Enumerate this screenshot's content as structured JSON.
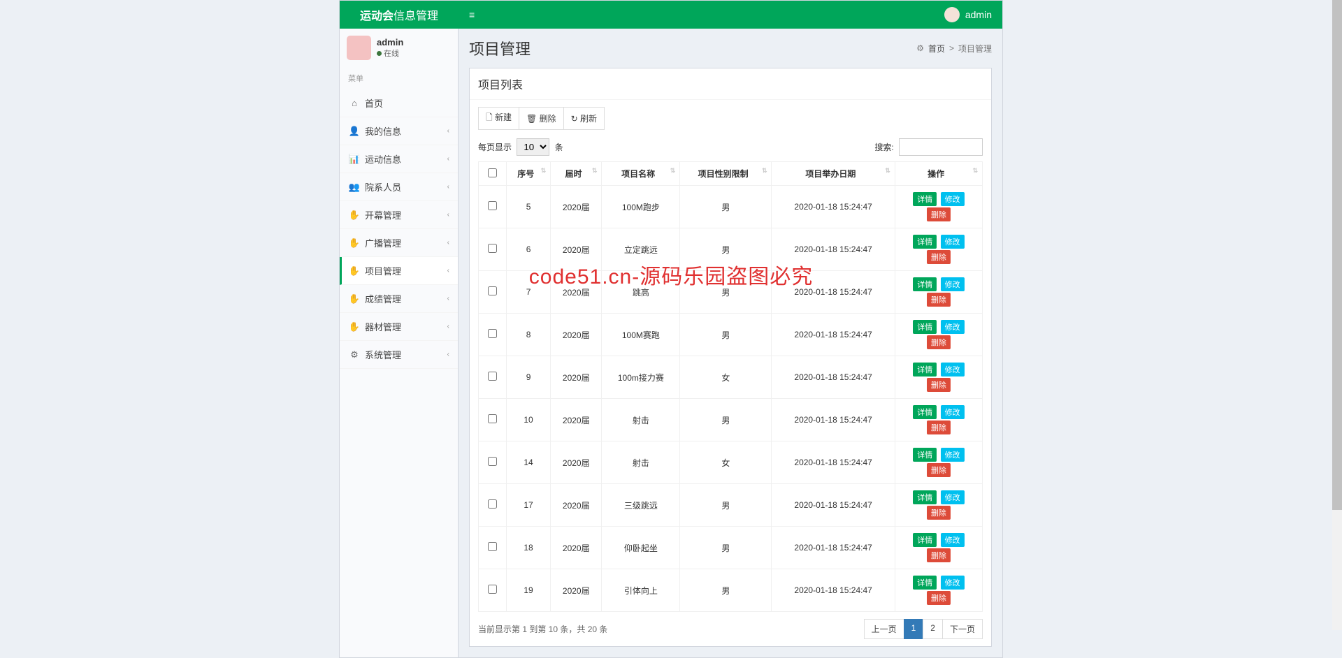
{
  "header": {
    "brand_strong": "运动会",
    "brand_light": "信息管理",
    "user": "admin"
  },
  "sidebar": {
    "user": {
      "name": "admin",
      "status": "在线"
    },
    "menu_header": "菜单",
    "items": [
      {
        "icon": "⌂",
        "label": "首页",
        "expand": false
      },
      {
        "icon": "👤",
        "label": "我的信息",
        "expand": true
      },
      {
        "icon": "📊",
        "label": "运动信息",
        "expand": true
      },
      {
        "icon": "👥",
        "label": "院系人员",
        "expand": true
      },
      {
        "icon": "✋",
        "label": "开幕管理",
        "expand": true
      },
      {
        "icon": "✋",
        "label": "广播管理",
        "expand": true
      },
      {
        "icon": "✋",
        "label": "项目管理",
        "expand": true,
        "active": true
      },
      {
        "icon": "✋",
        "label": "成绩管理",
        "expand": true
      },
      {
        "icon": "✋",
        "label": "器材管理",
        "expand": true
      },
      {
        "icon": "⚙",
        "label": "系统管理",
        "expand": true
      }
    ]
  },
  "content": {
    "title": "项目管理",
    "breadcrumb": {
      "icon": "⚙",
      "home": "首页",
      "sep": ">",
      "current": "项目管理"
    },
    "box_title": "项目列表",
    "toolbar": {
      "new": "新建",
      "delete": "删除",
      "refresh": "刷新"
    },
    "length": {
      "prefix": "每页显示",
      "value": "10",
      "suffix": "条"
    },
    "search_label": "搜索:",
    "columns": [
      "",
      "序号",
      "届时",
      "项目名称",
      "项目性别限制",
      "项目举办日期",
      "操作"
    ],
    "rows": [
      {
        "id": "5",
        "session": "2020届",
        "name": "100M跑步",
        "gender": "男",
        "date": "2020-01-18 15:24:47"
      },
      {
        "id": "6",
        "session": "2020届",
        "name": "立定跳远",
        "gender": "男",
        "date": "2020-01-18 15:24:47"
      },
      {
        "id": "7",
        "session": "2020届",
        "name": "跳高",
        "gender": "男",
        "date": "2020-01-18 15:24:47"
      },
      {
        "id": "8",
        "session": "2020届",
        "name": "100M赛跑",
        "gender": "男",
        "date": "2020-01-18 15:24:47"
      },
      {
        "id": "9",
        "session": "2020届",
        "name": "100m接力赛",
        "gender": "女",
        "date": "2020-01-18 15:24:47"
      },
      {
        "id": "10",
        "session": "2020届",
        "name": "射击",
        "gender": "男",
        "date": "2020-01-18 15:24:47"
      },
      {
        "id": "14",
        "session": "2020届",
        "name": "射击",
        "gender": "女",
        "date": "2020-01-18 15:24:47"
      },
      {
        "id": "17",
        "session": "2020届",
        "name": "三级跳远",
        "gender": "男",
        "date": "2020-01-18 15:24:47"
      },
      {
        "id": "18",
        "session": "2020届",
        "name": "仰卧起坐",
        "gender": "男",
        "date": "2020-01-18 15:24:47"
      },
      {
        "id": "19",
        "session": "2020届",
        "name": "引体向上",
        "gender": "男",
        "date": "2020-01-18 15:24:47"
      }
    ],
    "actions": {
      "detail": "详情",
      "edit": "修改",
      "del": "删除"
    },
    "info": "当前显示第 1 到第 10 条，共 20 条",
    "pagination": {
      "prev": "上一页",
      "pages": [
        "1",
        "2"
      ],
      "next": "下一页"
    }
  },
  "watermark": "code51.cn-源码乐园盗图必究"
}
